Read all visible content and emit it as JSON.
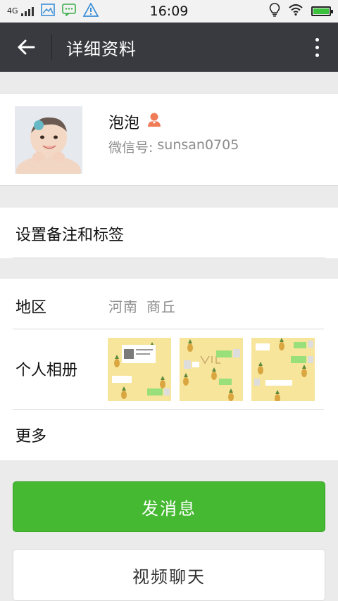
{
  "status_bar": {
    "network": "4G",
    "time": "16:09"
  },
  "header": {
    "title": "详细资料"
  },
  "profile": {
    "name": "泡泡",
    "wechat_id_label": "微信号:",
    "wechat_id": "sunsan0705",
    "gender_icon_color": "#f07b57"
  },
  "remark": {
    "label": "设置备注和标签"
  },
  "info": {
    "region_label": "地区",
    "region_province": "河南",
    "region_city": "商丘",
    "album_label": "个人相册",
    "more_label": "更多"
  },
  "actions": {
    "send_message": "发消息",
    "video_chat": "视频聊天"
  },
  "colors": {
    "header_bg": "#393a3f",
    "primary_green": "#44b931",
    "page_bg": "#ebebeb"
  }
}
